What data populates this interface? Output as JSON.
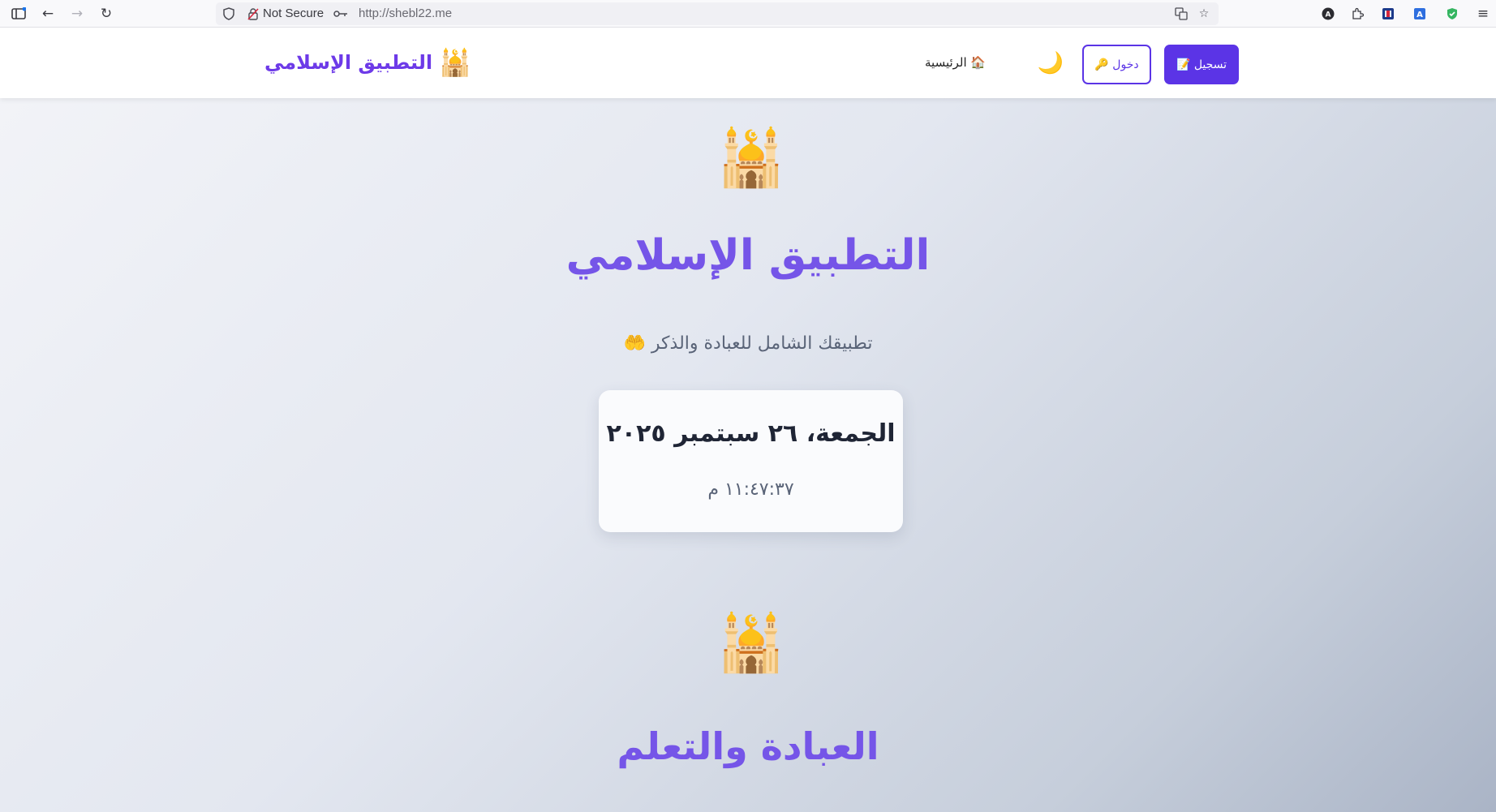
{
  "browser": {
    "security_label": "Not Secure",
    "url": "http://shebl22.me"
  },
  "site": {
    "brand_text": "التطبيق الإسلامي",
    "brand_icon": "🕌",
    "nav": {
      "register_label": "تسجيل 📝",
      "login_label": "دخول 🔑",
      "theme_icon": "🌙",
      "home_label": "🏠 الرئيسية"
    }
  },
  "hero": {
    "icon": "🕌",
    "title": "التطبيق الإسلامي",
    "subtitle": "تطبيقك الشامل للعبادة والذكر 🤲"
  },
  "date_card": {
    "date": "الجمعة، ٢٦ سبتمبر ٢٠٢٥",
    "time": "١١:٤٧:٣٧ م"
  },
  "section": {
    "icon": "🕌",
    "title": "العبادة والتعلم"
  },
  "colors": {
    "brand": "#6d3ae8",
    "primary_button": "#5b34e6",
    "heading": "#7555e8"
  }
}
